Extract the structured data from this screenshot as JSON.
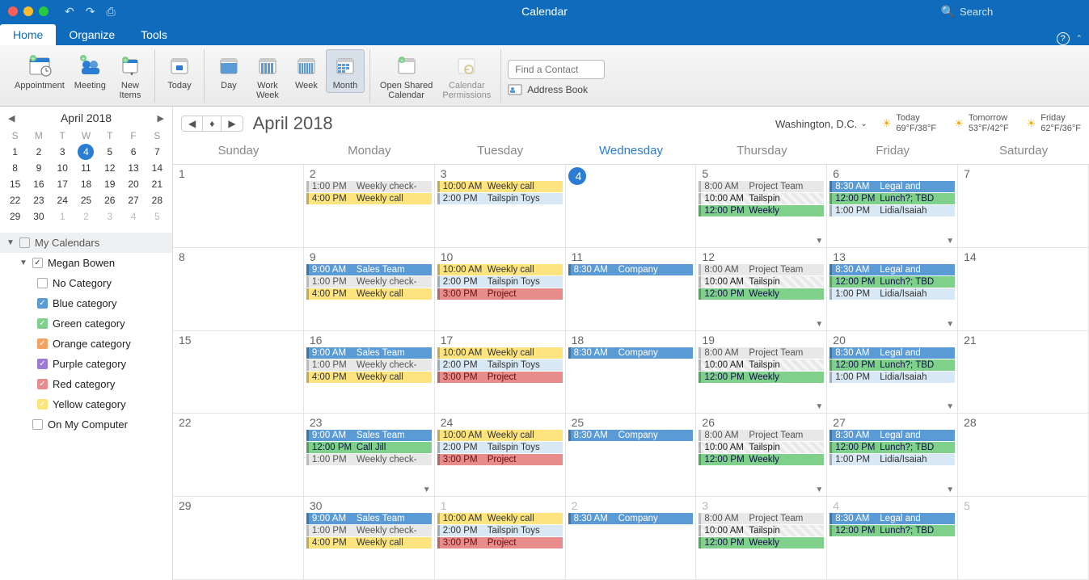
{
  "window": {
    "title": "Calendar",
    "search_placeholder": "Search"
  },
  "tabs": {
    "home": "Home",
    "organize": "Organize",
    "tools": "Tools"
  },
  "ribbon": {
    "appointment": "Appointment",
    "meeting": "Meeting",
    "new_items": "New\nItems",
    "today": "Today",
    "day": "Day",
    "work_week": "Work\nWeek",
    "week": "Week",
    "month": "Month",
    "open_shared": "Open Shared\nCalendar",
    "cal_perm": "Calendar\nPermissions",
    "find_contact_placeholder": "Find a Contact",
    "address_book": "Address Book"
  },
  "mini": {
    "title": "April 2018",
    "dow": [
      "S",
      "M",
      "T",
      "W",
      "T",
      "F",
      "S"
    ],
    "weeks": [
      [
        {
          "n": 1
        },
        {
          "n": 2
        },
        {
          "n": 3
        },
        {
          "n": 4,
          "today": true
        },
        {
          "n": 5
        },
        {
          "n": 6
        },
        {
          "n": 7
        }
      ],
      [
        {
          "n": 8
        },
        {
          "n": 9
        },
        {
          "n": 10
        },
        {
          "n": 11
        },
        {
          "n": 12
        },
        {
          "n": 13
        },
        {
          "n": 14
        }
      ],
      [
        {
          "n": 15
        },
        {
          "n": 16
        },
        {
          "n": 17
        },
        {
          "n": 18
        },
        {
          "n": 19
        },
        {
          "n": 20
        },
        {
          "n": 21
        }
      ],
      [
        {
          "n": 22
        },
        {
          "n": 23
        },
        {
          "n": 24
        },
        {
          "n": 25
        },
        {
          "n": 26
        },
        {
          "n": 27
        },
        {
          "n": 28
        }
      ],
      [
        {
          "n": 29
        },
        {
          "n": 30
        },
        {
          "n": 1,
          "dim": true
        },
        {
          "n": 2,
          "dim": true
        },
        {
          "n": 3,
          "dim": true
        },
        {
          "n": 4,
          "dim": true
        },
        {
          "n": 5,
          "dim": true
        }
      ]
    ]
  },
  "tree": {
    "my_calendars": "My Calendars",
    "owner": "Megan Bowen",
    "categories": [
      {
        "label": "No Category",
        "color": "#ffffff",
        "checked": false
      },
      {
        "label": "Blue category",
        "color": "#5a9bd5",
        "checked": true
      },
      {
        "label": "Green category",
        "color": "#7ed08a",
        "checked": true
      },
      {
        "label": "Orange category",
        "color": "#f4a261",
        "checked": true
      },
      {
        "label": "Purple category",
        "color": "#9c7bd6",
        "checked": true
      },
      {
        "label": "Red category",
        "color": "#e78b8b",
        "checked": true
      },
      {
        "label": "Yellow category",
        "color": "#fde47f",
        "checked": true
      }
    ],
    "on_my_computer": "On My Computer"
  },
  "cal": {
    "month": "April 2018",
    "location": "Washington,  D.C.",
    "weather": [
      {
        "label": "Today",
        "temp": "69°F/38°F"
      },
      {
        "label": "Tomorrow",
        "temp": "53°F/42°F"
      },
      {
        "label": "Friday",
        "temp": "62°F/36°F"
      }
    ],
    "daynames": [
      "Sunday",
      "Monday",
      "Tuesday",
      "Wednesday",
      "Thursday",
      "Friday",
      "Saturday"
    ],
    "today_col": 3,
    "weeks": [
      [
        {
          "n": 1
        },
        {
          "n": 2,
          "evts": [
            {
              "t": "1:00 PM",
              "s": "Weekly check-",
              "c": "gray"
            },
            {
              "t": "4:00 PM",
              "s": "Weekly call",
              "c": "yellow"
            }
          ]
        },
        {
          "n": 3,
          "evts": [
            {
              "t": "10:00 AM",
              "s": "Weekly call",
              "c": "yellow"
            },
            {
              "t": "2:00 PM",
              "s": "Tailspin Toys",
              "c": "lblue"
            }
          ]
        },
        {
          "n": 4,
          "today": true
        },
        {
          "n": 5,
          "more": true,
          "evts": [
            {
              "t": "8:00 AM",
              "s": "Project Team",
              "c": "gray"
            },
            {
              "t": "10:00 AM",
              "s": "Tailspin",
              "c": "hatch"
            },
            {
              "t": "12:00 PM",
              "s": "Weekly",
              "c": "green"
            }
          ]
        },
        {
          "n": 6,
          "more": true,
          "evts": [
            {
              "t": "8:30 AM",
              "s": "Legal and",
              "c": "blue"
            },
            {
              "t": "12:00 PM",
              "s": "Lunch?; TBD",
              "c": "green"
            },
            {
              "t": "1:00 PM",
              "s": "Lidia/Isaiah",
              "c": "lblue"
            }
          ]
        },
        {
          "n": 7
        }
      ],
      [
        {
          "n": 8
        },
        {
          "n": 9,
          "evts": [
            {
              "t": "9:00 AM",
              "s": "Sales Team",
              "c": "blue"
            },
            {
              "t": "1:00 PM",
              "s": "Weekly check-",
              "c": "gray"
            },
            {
              "t": "4:00 PM",
              "s": "Weekly call",
              "c": "yellow"
            }
          ]
        },
        {
          "n": 10,
          "evts": [
            {
              "t": "10:00 AM",
              "s": "Weekly call",
              "c": "yellow"
            },
            {
              "t": "2:00 PM",
              "s": "Tailspin Toys",
              "c": "lblue"
            },
            {
              "t": "3:00 PM",
              "s": "Project",
              "c": "red"
            }
          ]
        },
        {
          "n": 11,
          "evts": [
            {
              "t": "8:30 AM",
              "s": "Company",
              "c": "blue"
            }
          ]
        },
        {
          "n": 12,
          "more": true,
          "evts": [
            {
              "t": "8:00 AM",
              "s": "Project Team",
              "c": "gray"
            },
            {
              "t": "10:00 AM",
              "s": "Tailspin",
              "c": "hatch"
            },
            {
              "t": "12:00 PM",
              "s": "Weekly",
              "c": "green"
            }
          ]
        },
        {
          "n": 13,
          "more": true,
          "evts": [
            {
              "t": "8:30 AM",
              "s": "Legal and",
              "c": "blue"
            },
            {
              "t": "12:00 PM",
              "s": "Lunch?; TBD",
              "c": "green"
            },
            {
              "t": "1:00 PM",
              "s": "Lidia/Isaiah",
              "c": "lblue"
            }
          ]
        },
        {
          "n": 14
        }
      ],
      [
        {
          "n": 15
        },
        {
          "n": 16,
          "evts": [
            {
              "t": "9:00 AM",
              "s": "Sales Team",
              "c": "blue"
            },
            {
              "t": "1:00 PM",
              "s": "Weekly check-",
              "c": "gray"
            },
            {
              "t": "4:00 PM",
              "s": "Weekly call",
              "c": "yellow"
            }
          ]
        },
        {
          "n": 17,
          "evts": [
            {
              "t": "10:00 AM",
              "s": "Weekly call",
              "c": "yellow"
            },
            {
              "t": "2:00 PM",
              "s": "Tailspin Toys",
              "c": "lblue"
            },
            {
              "t": "3:00 PM",
              "s": "Project",
              "c": "red"
            }
          ]
        },
        {
          "n": 18,
          "evts": [
            {
              "t": "8:30 AM",
              "s": "Company",
              "c": "blue"
            }
          ]
        },
        {
          "n": 19,
          "more": true,
          "evts": [
            {
              "t": "8:00 AM",
              "s": "Project Team",
              "c": "gray"
            },
            {
              "t": "10:00 AM",
              "s": "Tailspin",
              "c": "hatch"
            },
            {
              "t": "12:00 PM",
              "s": "Weekly",
              "c": "green"
            }
          ]
        },
        {
          "n": 20,
          "more": true,
          "evts": [
            {
              "t": "8:30 AM",
              "s": "Legal and",
              "c": "blue"
            },
            {
              "t": "12:00 PM",
              "s": "Lunch?; TBD",
              "c": "green"
            },
            {
              "t": "1:00 PM",
              "s": "Lidia/Isaiah",
              "c": "lblue"
            }
          ]
        },
        {
          "n": 21
        }
      ],
      [
        {
          "n": 22
        },
        {
          "n": 23,
          "more": true,
          "evts": [
            {
              "t": "9:00 AM",
              "s": "Sales Team",
              "c": "blue"
            },
            {
              "t": "12:00 PM",
              "s": "Call Jill",
              "c": "green"
            },
            {
              "t": "1:00 PM",
              "s": "Weekly check-",
              "c": "gray"
            }
          ]
        },
        {
          "n": 24,
          "evts": [
            {
              "t": "10:00 AM",
              "s": "Weekly call",
              "c": "yellow"
            },
            {
              "t": "2:00 PM",
              "s": "Tailspin Toys",
              "c": "lblue"
            },
            {
              "t": "3:00 PM",
              "s": "Project",
              "c": "red"
            }
          ]
        },
        {
          "n": 25,
          "evts": [
            {
              "t": "8:30 AM",
              "s": "Company",
              "c": "blue"
            }
          ]
        },
        {
          "n": 26,
          "more": true,
          "evts": [
            {
              "t": "8:00 AM",
              "s": "Project Team",
              "c": "gray"
            },
            {
              "t": "10:00 AM",
              "s": "Tailspin",
              "c": "hatch"
            },
            {
              "t": "12:00 PM",
              "s": "Weekly",
              "c": "green"
            }
          ]
        },
        {
          "n": 27,
          "more": true,
          "evts": [
            {
              "t": "8:30 AM",
              "s": "Legal and",
              "c": "blue"
            },
            {
              "t": "12:00 PM",
              "s": "Lunch?; TBD",
              "c": "green"
            },
            {
              "t": "1:00 PM",
              "s": "Lidia/Isaiah",
              "c": "lblue"
            }
          ]
        },
        {
          "n": 28
        }
      ],
      [
        {
          "n": 29
        },
        {
          "n": 30,
          "evts": [
            {
              "t": "9:00 AM",
              "s": "Sales Team",
              "c": "blue"
            },
            {
              "t": "1:00 PM",
              "s": "Weekly check-",
              "c": "gray"
            },
            {
              "t": "4:00 PM",
              "s": "Weekly call",
              "c": "yellow"
            }
          ]
        },
        {
          "n": 1,
          "dim": true,
          "evts": [
            {
              "t": "10:00 AM",
              "s": "Weekly call",
              "c": "yellow"
            },
            {
              "t": "2:00 PM",
              "s": "Tailspin Toys",
              "c": "lblue"
            },
            {
              "t": "3:00 PM",
              "s": "Project",
              "c": "red"
            }
          ]
        },
        {
          "n": 2,
          "dim": true,
          "evts": [
            {
              "t": "8:30 AM",
              "s": "Company",
              "c": "blue"
            }
          ]
        },
        {
          "n": 3,
          "dim": true,
          "evts": [
            {
              "t": "8:00 AM",
              "s": "Project Team",
              "c": "gray"
            },
            {
              "t": "10:00 AM",
              "s": "Tailspin",
              "c": "hatch"
            },
            {
              "t": "12:00 PM",
              "s": "Weekly",
              "c": "green"
            }
          ]
        },
        {
          "n": 4,
          "dim": true,
          "evts": [
            {
              "t": "8:30 AM",
              "s": "Legal and",
              "c": "blue"
            },
            {
              "t": "12:00 PM",
              "s": "Lunch?; TBD",
              "c": "green"
            }
          ]
        },
        {
          "n": 5,
          "dim": true
        }
      ]
    ]
  }
}
